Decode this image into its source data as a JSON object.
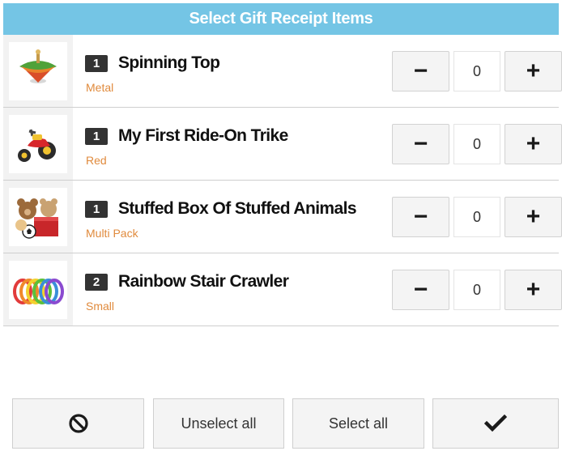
{
  "header": {
    "title": "Select Gift Receipt Items"
  },
  "items": [
    {
      "qty": "1",
      "name": "Spinning Top",
      "variant": "Metal",
      "count": "0",
      "icon": "spinning-top-image"
    },
    {
      "qty": "1",
      "name": "My First Ride-On Trike",
      "variant": "Red",
      "count": "0",
      "icon": "trike-image"
    },
    {
      "qty": "1",
      "name": "Stuffed Box Of Stuffed Animals",
      "variant": "Multi Pack",
      "count": "0",
      "icon": "stuffed-animals-image"
    },
    {
      "qty": "2",
      "name": "Rainbow Stair Crawler",
      "variant": "Small",
      "count": "0",
      "icon": "rainbow-spring-image"
    }
  ],
  "stepper": {
    "minus_symbol": "−",
    "plus_symbol": "+"
  },
  "footer": {
    "cancel_icon": "no-entry-icon",
    "unselect_all_label": "Unselect all",
    "select_all_label": "Select all",
    "confirm_icon": "checkmark-icon"
  },
  "colors": {
    "header_bg": "#74c5e5",
    "variant_text": "#e08a3c",
    "badge_bg": "#333333"
  }
}
